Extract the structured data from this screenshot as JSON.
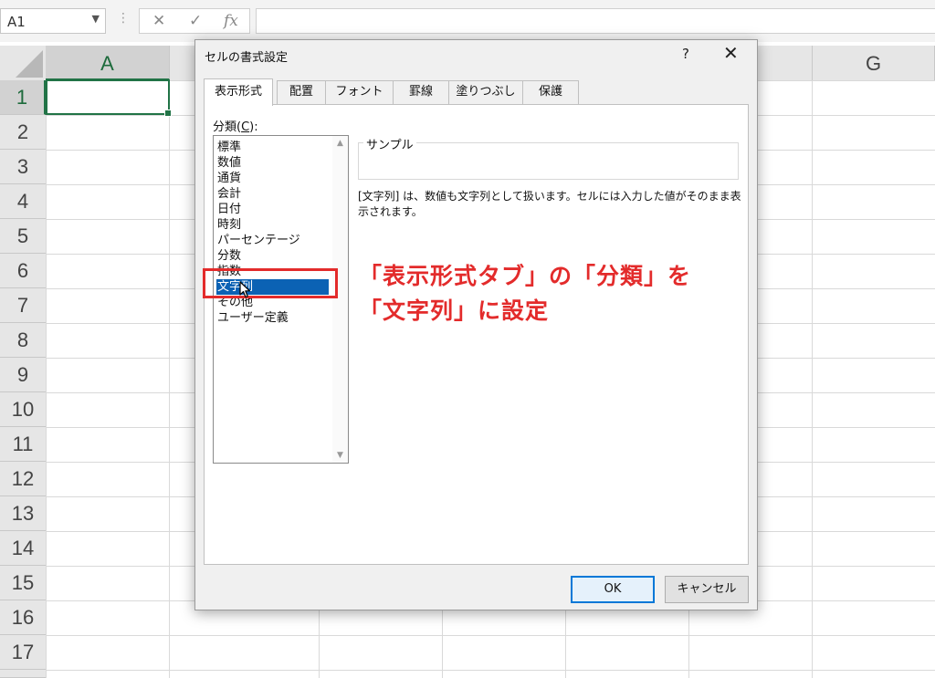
{
  "formula_bar": {
    "name_box": "A1",
    "cancel_icon": "✕",
    "enter_icon": "✓",
    "fx_label": "fx",
    "formula_value": ""
  },
  "sheet": {
    "columns": [
      "A",
      "G"
    ],
    "rows": [
      "1",
      "2",
      "3",
      "4",
      "5",
      "6",
      "7",
      "8",
      "9",
      "10",
      "11",
      "12",
      "13",
      "14",
      "15",
      "16",
      "17"
    ],
    "selected_cell": "A1",
    "accent_color": "#217346"
  },
  "dialog": {
    "title": "セルの書式設定",
    "help": "?",
    "close": "✕",
    "tabs": [
      {
        "label": "表示形式",
        "active": true
      },
      {
        "label": "配置"
      },
      {
        "label": "フォント"
      },
      {
        "label": "罫線"
      },
      {
        "label": "塗りつぶし"
      },
      {
        "label": "保護"
      }
    ],
    "category_label_prefix": "分類(",
    "category_label_key": "C",
    "category_label_suffix": "):",
    "categories": [
      "標準",
      "数値",
      "通貨",
      "会計",
      "日付",
      "時刻",
      "パーセンテージ",
      "分数",
      "指数",
      "文字列",
      "その他",
      "ユーザー定義"
    ],
    "selected_category": "文字列",
    "sample_label": "サンプル",
    "sample_value": "",
    "description": "[文字列] は、数値も文字列として扱います。セルには入力した値がそのまま表示されます。",
    "ok_label": "OK",
    "cancel_label": "キャンセル"
  },
  "annotation": {
    "line1": "「表示形式タブ」の「分類」を",
    "line2": "「文字列」に設定",
    "color": "#e32b2b"
  }
}
